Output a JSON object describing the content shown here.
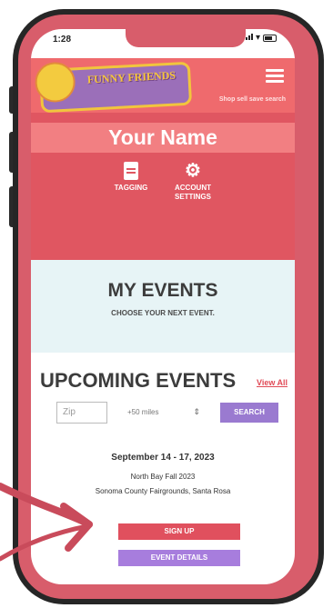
{
  "status": {
    "time": "1:28"
  },
  "header": {
    "logo_text": "FUNNY FRIENDS",
    "small_text": "",
    "tagline": "Shop sell save search"
  },
  "profile": {
    "name": "Your Name",
    "actions": [
      {
        "label_line1": "TAGGING",
        "label_line2": ""
      },
      {
        "label_line1": "ACCOUNT",
        "label_line2": "SETTINGS"
      }
    ]
  },
  "my_events": {
    "title": "MY EVENTS",
    "subtitle": "CHOOSE YOUR NEXT EVENT."
  },
  "upcoming": {
    "title": "UPCOMING EVENTS",
    "view_all": "View All",
    "zip_placeholder": "Zip",
    "distance": "+50 miles",
    "search_label": "SEARCH"
  },
  "event": {
    "date": "September 14 - 17, 2023",
    "name": "North Bay Fall 2023",
    "location": "Sonoma County Fairgrounds, Santa Rosa",
    "signup_label": "SIGN UP",
    "details_label": "EVENT DETAILS"
  },
  "colors": {
    "bezel": "#d85d6b",
    "header": "#ef6a6d",
    "profile": "#e05661",
    "purple": "#9a7ad0",
    "arrow": "#c94b5b"
  }
}
